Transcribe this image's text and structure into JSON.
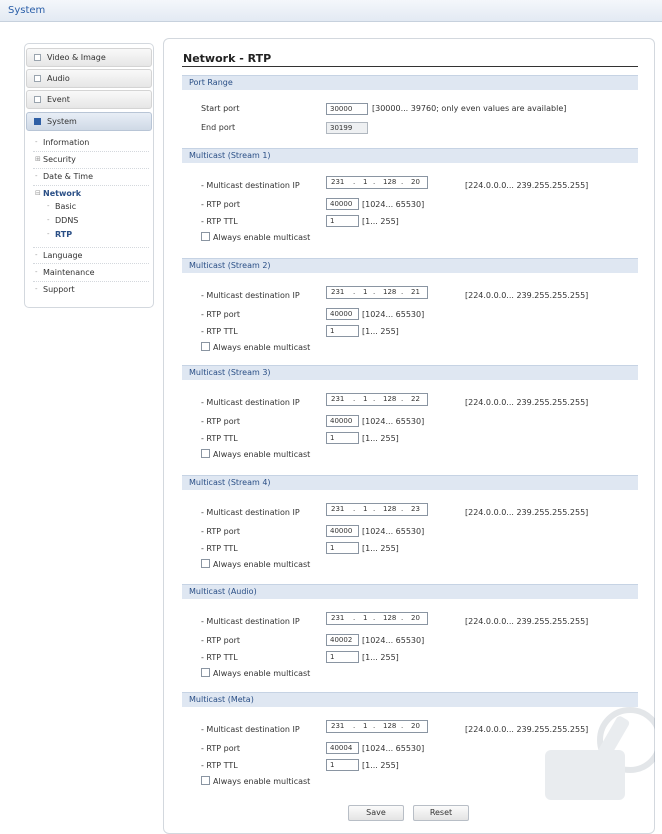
{
  "topbar": {
    "title": "System"
  },
  "nav": {
    "main": [
      {
        "label": "Video & Image"
      },
      {
        "label": "Audio"
      },
      {
        "label": "Event"
      },
      {
        "label": "System"
      }
    ],
    "sub": [
      {
        "label": "Information",
        "marker": "-"
      },
      {
        "label": "Security",
        "marker": "⊞"
      },
      {
        "label": "Date & Time",
        "marker": "-"
      },
      {
        "label": "Network",
        "marker": "⊟"
      },
      {
        "label": "Language",
        "marker": "-"
      },
      {
        "label": "Maintenance",
        "marker": "-"
      },
      {
        "label": "Support",
        "marker": "-"
      }
    ],
    "network_children": [
      {
        "label": "Basic"
      },
      {
        "label": "DDNS"
      },
      {
        "label": "RTP"
      }
    ]
  },
  "page": {
    "title": "Network - RTP",
    "port_range": {
      "heading": "Port Range",
      "start_label": "Start port",
      "start_value": "30000",
      "start_hint": "[30000... 39760; only even values are available]",
      "end_label": "End port",
      "end_value": "30199"
    },
    "labels": {
      "dest_ip": "- Multicast destination IP",
      "rtp_port": "- RTP port",
      "rtp_ttl": "- RTP TTL",
      "always": "Always enable multicast",
      "ip_range": "[224.0.0.0... 239.255.255.255]",
      "port_range": "[1024... 65530]",
      "ttl_range": "[1... 255]"
    },
    "sections": [
      {
        "heading": "Multicast (Stream 1)",
        "ip": [
          "231",
          "1",
          "128",
          "20"
        ],
        "dots": [
          ".",
          ".",
          "."
        ],
        "port": "40000",
        "ttl": "1"
      },
      {
        "heading": "Multicast (Stream 2)",
        "ip": [
          "231",
          "1",
          "128",
          "21"
        ],
        "dots": [
          ".",
          ".",
          "."
        ],
        "port": "40000",
        "ttl": "1"
      },
      {
        "heading": "Multicast (Stream 3)",
        "ip": [
          "231",
          "1",
          "128",
          "22"
        ],
        "dots": [
          ".",
          ".",
          "."
        ],
        "port": "40000",
        "ttl": "1"
      },
      {
        "heading": "Multicast (Stream 4)",
        "ip": [
          "231",
          "1",
          "128",
          "23"
        ],
        "dots": [
          ".",
          ".",
          "."
        ],
        "port": "40000",
        "ttl": "1"
      },
      {
        "heading": "Multicast (Audio)",
        "ip": [
          "231",
          "1",
          "128",
          "20"
        ],
        "dots": [
          ".",
          ".",
          "."
        ],
        "port": "40002",
        "ttl": "1"
      },
      {
        "heading": "Multicast (Meta)",
        "ip": [
          "231",
          "1",
          "128",
          "20"
        ],
        "dots": [
          ".",
          ".",
          "."
        ],
        "port": "40004",
        "ttl": "1"
      }
    ],
    "buttons": {
      "save": "Save",
      "reset": "Reset"
    }
  }
}
